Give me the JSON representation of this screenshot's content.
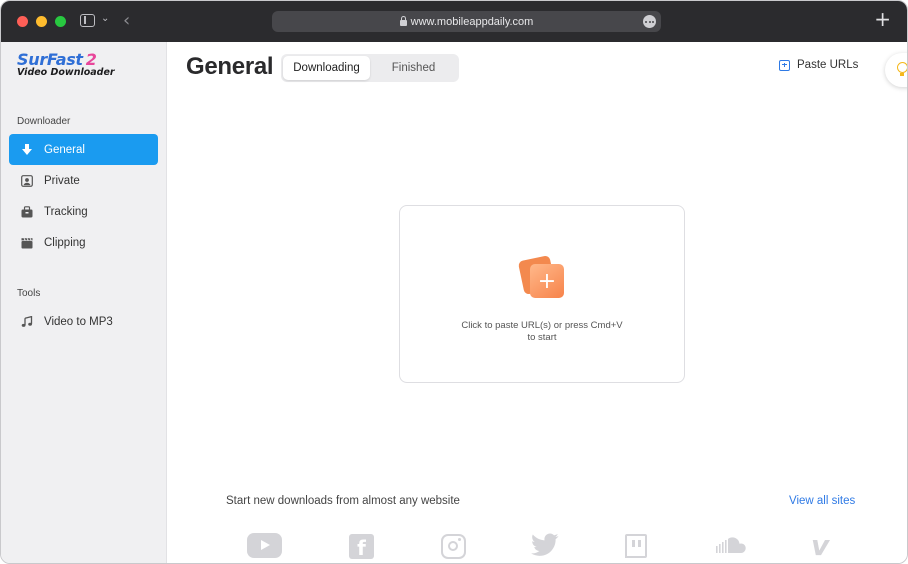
{
  "browser": {
    "url": "www.mobileappdaily.com"
  },
  "app": {
    "logo_title": "SurFast",
    "logo_version": "2",
    "logo_subtitle": "Video Downloader"
  },
  "sidebar": {
    "sections": [
      {
        "label": "Downloader",
        "items": [
          {
            "label": "General",
            "icon": "download-arrow-icon",
            "active": true
          },
          {
            "label": "Private",
            "icon": "private-user-icon",
            "active": false
          },
          {
            "label": "Tracking",
            "icon": "tracking-box-icon",
            "active": false
          },
          {
            "label": "Clipping",
            "icon": "clapperboard-icon",
            "active": false
          }
        ]
      },
      {
        "label": "Tools",
        "items": [
          {
            "label": "Video to MP3",
            "icon": "music-note-icon",
            "active": false
          }
        ]
      }
    ]
  },
  "main": {
    "title": "General",
    "tabs": [
      {
        "label": "Downloading",
        "active": true
      },
      {
        "label": "Finished",
        "active": false
      }
    ],
    "paste_urls_label": "Paste URLs",
    "dropzone_text_line1": "Click to paste URL(s) or press Cmd+V",
    "dropzone_text_line2": "to start",
    "sites_text": "Start new downloads from almost any website",
    "view_all_label": "View all sites",
    "site_icons": [
      "youtube-icon",
      "facebook-icon",
      "instagram-icon",
      "twitter-icon",
      "twitch-icon",
      "soundcloud-icon",
      "vimeo-icon"
    ]
  },
  "colors": {
    "accent": "#1a9bf0",
    "link": "#2f7ae5",
    "drop_icon_orange": "#f7834a",
    "logo_blue": "#2f6fd6",
    "logo_pink": "#e8469a",
    "titlebar": "#2b2b2e"
  }
}
